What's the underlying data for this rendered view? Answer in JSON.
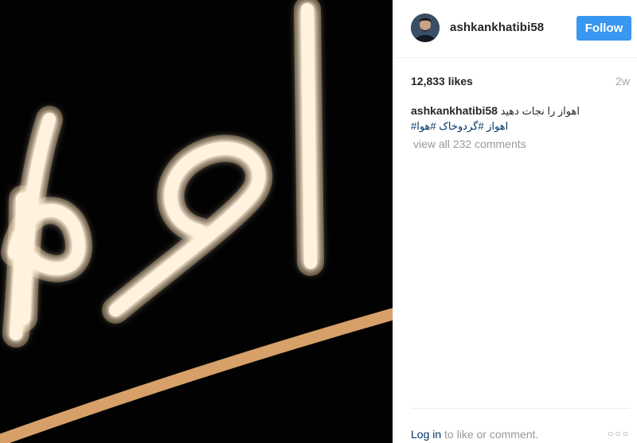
{
  "header": {
    "username": "ashkankhatibi58",
    "follow_label": "Follow"
  },
  "post": {
    "likes": "12,833 likes",
    "age": "2w",
    "caption": {
      "username": "ashkankhatibi58",
      "text": "اهواز را نجات دهید",
      "hashtags": "اهواز #گردوخاک #هوا#"
    },
    "view_comments": "view all 232 comments"
  },
  "footer": {
    "login_label": "Log in",
    "login_suffix": " to like or comment.",
    "more_icon": "more-options-icon"
  },
  "colors": {
    "follow_button": "#3897f0",
    "link": "#003569",
    "muted": "#999999",
    "neon": "#ffe8c2",
    "stroke": "#d6a068"
  }
}
